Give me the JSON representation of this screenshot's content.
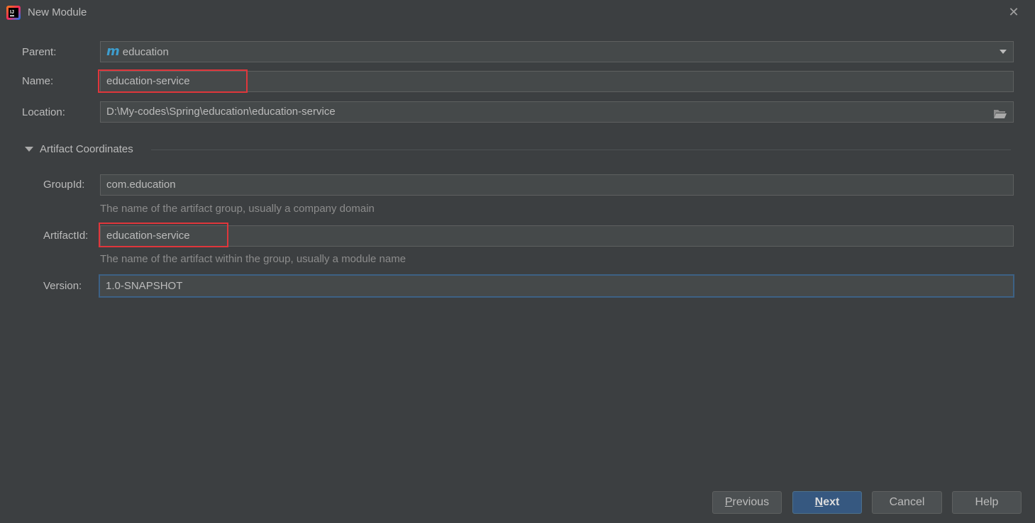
{
  "window": {
    "title": "New Module",
    "close_symbol": "✕"
  },
  "form": {
    "parent": {
      "label": "Parent:",
      "value": "education",
      "icon": "maven-m-icon",
      "icon_glyph": "m"
    },
    "name": {
      "label": "Name:",
      "value": "education-service"
    },
    "location": {
      "label": "Location:",
      "value": "D:\\My-codes\\Spring\\education\\education-service"
    }
  },
  "artifact": {
    "section_title": "Artifact Coordinates",
    "group_id": {
      "label": "GroupId:",
      "value": "com.education",
      "hint": "The name of the artifact group, usually a company domain"
    },
    "artifact_id": {
      "label": "ArtifactId:",
      "value": "education-service",
      "hint": "The name of the artifact within the group, usually a module name"
    },
    "version": {
      "label": "Version:",
      "value": "1.0-SNAPSHOT"
    }
  },
  "buttons": {
    "previous": {
      "mnemonic": "P",
      "rest": "revious"
    },
    "next": {
      "mnemonic": "N",
      "rest": "ext"
    },
    "cancel": "Cancel",
    "help": "Help"
  },
  "colors": {
    "background": "#3c3f41",
    "field": "#45494a",
    "highlight_box": "#e0363b",
    "primary_button": "#365880",
    "focus": "#3d6185"
  }
}
